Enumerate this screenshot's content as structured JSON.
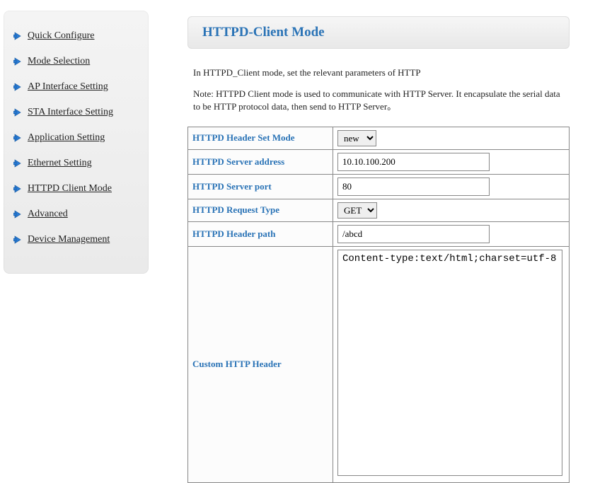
{
  "sidebar": {
    "items": [
      {
        "label": "Quick Configure"
      },
      {
        "label": "Mode Selection"
      },
      {
        "label": "AP Interface Setting"
      },
      {
        "label": "STA Interface Setting"
      },
      {
        "label": "Application Setting"
      },
      {
        "label": "Ethernet Setting"
      },
      {
        "label": "HTTPD Client Mode"
      },
      {
        "label": "Advanced"
      },
      {
        "label": "Device Management"
      }
    ]
  },
  "page": {
    "title": "HTTPD-Client Mode",
    "intro": "In HTTPD_Client mode, set the relevant parameters of HTTP",
    "note": "Note: HTTPD Client mode is used to communicate with HTTP Server. It encapsulate the serial data to be HTTP protocol data, then send to HTTP Server。"
  },
  "form": {
    "headerSetMode": {
      "label": "HTTPD Header Set Mode",
      "value": "new"
    },
    "serverAddress": {
      "label": "HTTPD Server address",
      "value": "10.10.100.200"
    },
    "serverPort": {
      "label": "HTTPD Server port",
      "value": "80"
    },
    "requestType": {
      "label": "HTTPD Request Type",
      "value": "GET"
    },
    "headerPath": {
      "label": "HTTPD Header path",
      "value": "/abcd"
    },
    "customHeader": {
      "label": "Custom HTTP Header",
      "value": "Content-type:text/html;charset=utf-8"
    }
  }
}
